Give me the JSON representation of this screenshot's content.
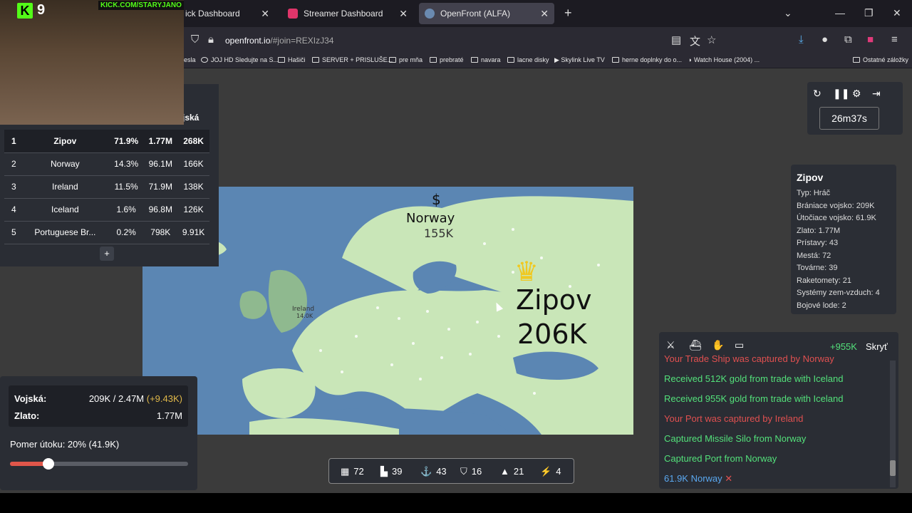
{
  "browser": {
    "tabs": [
      {
        "label": "ick Dashboard",
        "fav": "#3a3a3a"
      },
      {
        "label": "Streamer Dashboard",
        "fav": "#e0356a"
      },
      {
        "label": "OpenFront (ALFA)",
        "fav": "#6a8ab0"
      }
    ],
    "url": "openfront.io",
    "url_hash": "/#join=REXIzJ34",
    "bookmarks": [
      "esla",
      "JOJ HD Sledujte na S...",
      "Hašiči",
      "SERVER + PRISLUŠE...",
      "pre mňa",
      "prebraté",
      "navara",
      "lacne disky",
      "Skylink Live TV",
      "herne doplnky do o...",
      "Watch House (2004) ...",
      "Ostatné záložky"
    ]
  },
  "stream": {
    "viewer_count": "9",
    "channel_url": "KICK.COM/STARYJANO"
  },
  "leaderboard": {
    "header_fragment": "jská",
    "rows": [
      {
        "rank": "1",
        "name": "Zipov",
        "pct": "71.9%",
        "gold": "1.77M",
        "troops": "268K"
      },
      {
        "rank": "2",
        "name": "Norway",
        "pct": "14.3%",
        "gold": "96.1M",
        "troops": "166K"
      },
      {
        "rank": "3",
        "name": "Ireland",
        "pct": "11.5%",
        "gold": "71.9M",
        "troops": "138K"
      },
      {
        "rank": "4",
        "name": "Iceland",
        "pct": "1.6%",
        "gold": "96.8M",
        "troops": "126K"
      },
      {
        "rank": "5",
        "name": "Portuguese Br...",
        "pct": "0.2%",
        "gold": "798K",
        "troops": "9.91K"
      }
    ],
    "expand_label": "+"
  },
  "map": {
    "labels": {
      "norway_name": "Norway",
      "norway_troops": "155K",
      "ireland_name": "Ireland",
      "ireland_troops": "14.0K",
      "zipov_name": "Zipov",
      "zipov_troops": "206K"
    },
    "colors": {
      "sea": "#5b86b3",
      "land": "#c9e6b8",
      "uk": "#8fb98f"
    }
  },
  "controls": {
    "timer": "26m37s",
    "icons": [
      "restart-icon",
      "pause-icon",
      "settings-icon",
      "exit-icon"
    ]
  },
  "player_info": {
    "name": "Zipov",
    "stats": [
      "Typ: Hráč",
      "Brániace vojsko: 209K",
      "Útočiace vojsko: 61.9K",
      "Zlato: 1.77M",
      "Prístavy: 43",
      "Mestá: 72",
      "Továrne: 39",
      "Raketomety: 21",
      "Systémy zem-vzduch: 4",
      "Bojové lode: 2"
    ]
  },
  "events": {
    "gold_delta": "+955K",
    "hide_label": "Skryť",
    "lines": [
      {
        "text": "Your Trade Ship was captured by Norway",
        "color": "#e05050"
      },
      {
        "text": "Received 512K gold from trade with Iceland",
        "color": "#53e07a"
      },
      {
        "text": "Received 955K gold from trade with Iceland",
        "color": "#53e07a"
      },
      {
        "text": "Your Port was captured by Ireland",
        "color": "#e05050"
      },
      {
        "text": "Captured Missile Silo from Norway",
        "color": "#53e07a"
      },
      {
        "text": "Captured Port from Norway",
        "color": "#53e07a"
      },
      {
        "text": "61.9K Norway",
        "color": "#5aa8f0"
      }
    ]
  },
  "troops": {
    "troops_label": "Vojská:",
    "troops_value": "209K / 2.47M",
    "troops_gain": "(+9.43K)",
    "gold_label": "Zlato:",
    "gold_value": "1.77M",
    "ratio_label": "Pomer útoku: 20% (41.9K)",
    "ratio_fraction": 0.2
  },
  "buildings": [
    {
      "icon": "city-icon",
      "glyph": "▦",
      "count": "72"
    },
    {
      "icon": "factory-icon",
      "glyph": "▙",
      "count": "39"
    },
    {
      "icon": "anchor-icon",
      "glyph": "⚓",
      "count": "43"
    },
    {
      "icon": "shield-icon",
      "glyph": "⛉",
      "count": "16"
    },
    {
      "icon": "missile-icon",
      "glyph": "▲",
      "count": "21"
    },
    {
      "icon": "sam-icon",
      "glyph": "⚡",
      "count": "4"
    }
  ]
}
